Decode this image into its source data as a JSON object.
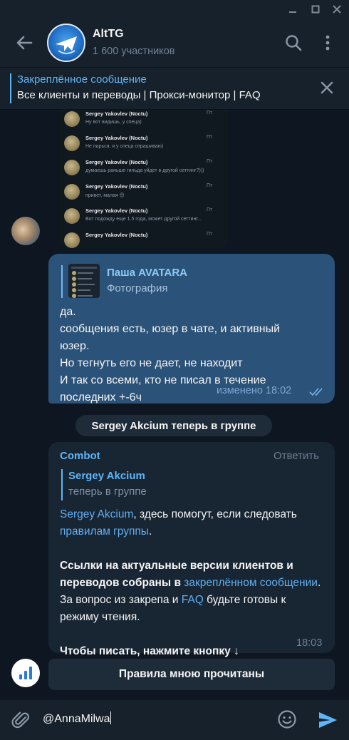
{
  "window": {
    "minimize_icon": "minimize-icon",
    "maximize_icon": "maximize-icon",
    "close_icon": "close-icon"
  },
  "header": {
    "title": "AltTG",
    "subtitle": "1 600 участников"
  },
  "pinned": {
    "title": "Закреплённое сообщение",
    "text": "Все клиенты и переводы | Прокси-монитор | FAQ"
  },
  "screenshot_preview": {
    "rows": [
      {
        "name": "Sergey Yakovlev (Noctu)",
        "time": "Пт",
        "message": "Ну вот видишь, у спеца)"
      },
      {
        "name": "Sergey Yakovlev (Noctu)",
        "time": "Пт",
        "message": "Не парься, я у спеца спрашиваю)"
      },
      {
        "name": "Sergey Yakovlev (Noctu)",
        "time": "Пт",
        "message": "думаешь раньше гильда уйдет в другой сеттинг?)))"
      },
      {
        "name": "Sergey Yakovlev (Noctu)",
        "time": "Пт",
        "message": "привет, малая 😊"
      },
      {
        "name": "Sergey Yakovlev (Noctu)",
        "time": "Пт",
        "message": "Вот подожду еще 1.5 года, может другой сеттинг..."
      },
      {
        "name": "Sergey Yakovlev (Noctu)",
        "time": "Пт",
        "message": ""
      }
    ]
  },
  "outgoing": {
    "reply_name": "Паша AVATARA",
    "reply_sub": "Фотография",
    "lines": [
      "да.",
      "сообщения есть, юзер в чате, и активный",
      "юзер.",
      "Но тегнуть его не дает, не находит",
      "И так со всеми, кто не писал в течение",
      "последних +-6ч"
    ],
    "meta": "изменено 18:02"
  },
  "service_message": "Sergey Akcium теперь в группе",
  "bot_message": {
    "sender": "Combot",
    "reply_action": "Ответить",
    "reply_name": "Sergey Akcium",
    "reply_sub": "теперь в группе",
    "p1_link1": "Sergey Akcium",
    "p1_text": ", здесь помогут, если следовать ",
    "p1_link2": "правилам группы",
    "p1_end": ".",
    "p2_bold": "Ссылки на актуальные версии клиентов и переводов собраны в ",
    "p2_link1": "закреплённом сообщении",
    "p2_text": ". За вопрос из закрепа и ",
    "p2_link2": "FAQ",
    "p2_end": " будьте готовы к режиму чтения.",
    "p3_bold": "Чтобы писать, нажмите кнопку ↓",
    "time": "18:03"
  },
  "keyboard_button": "Правила мною прочитаны",
  "composer": {
    "value": "@AnnaMilwa"
  },
  "colors": {
    "accent": "#5eb5f7",
    "outgoing_bubble": "#2b5278",
    "incoming_bubble": "#182533",
    "background": "#0e1621"
  }
}
